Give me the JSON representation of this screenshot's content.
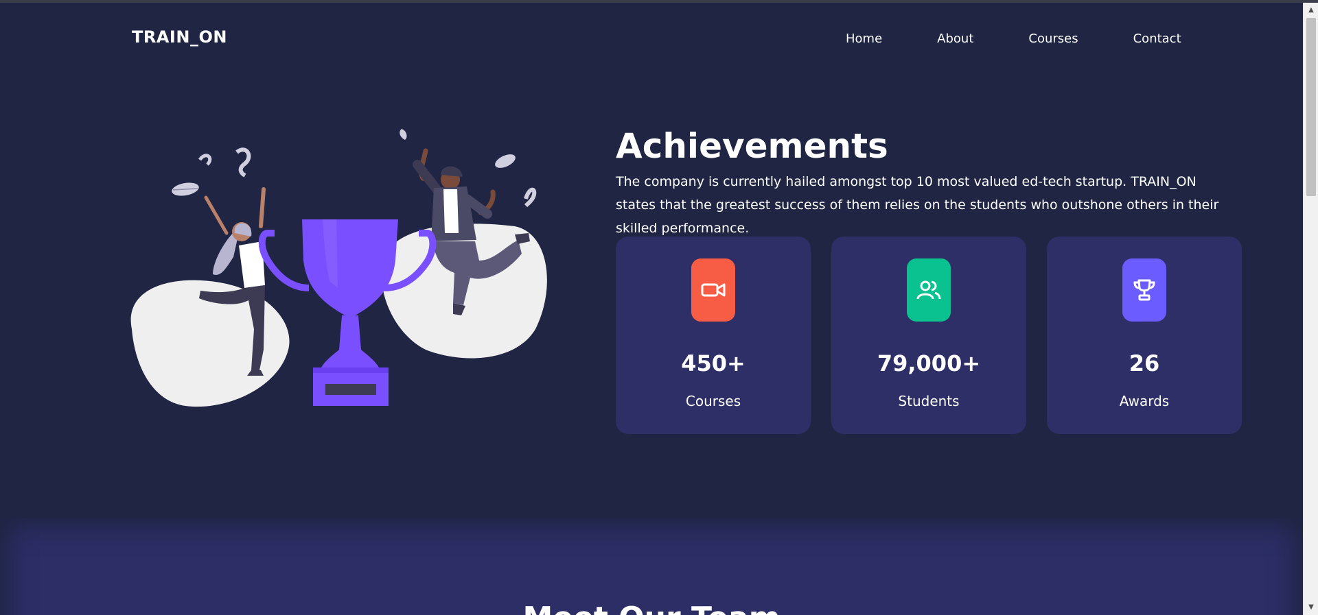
{
  "brand": {
    "name": "TRAIN_ON"
  },
  "nav": {
    "links": [
      "Home",
      "About",
      "Courses",
      "Contact"
    ]
  },
  "achievements": {
    "title": "Achievements",
    "description": "The company is currently hailed amongst top 10 most valued ed-tech startup. TRAIN_ON states that the greatest success of them relies on the students who outshone others in their skilled performance.",
    "stats": [
      {
        "value": "450+",
        "label": "Courses",
        "icon": "video-camera-icon",
        "color": "#f75c45"
      },
      {
        "value": "79,000+",
        "label": "Students",
        "icon": "users-icon",
        "color": "#0ac28f"
      },
      {
        "value": "26",
        "label": "Awards",
        "icon": "trophy-icon",
        "color": "#6b5cff"
      }
    ]
  },
  "team": {
    "title": "Meet Our Team"
  },
  "colors": {
    "background": "#1f2542",
    "card": "#2e2f66",
    "trophy": "#7a4fff"
  }
}
